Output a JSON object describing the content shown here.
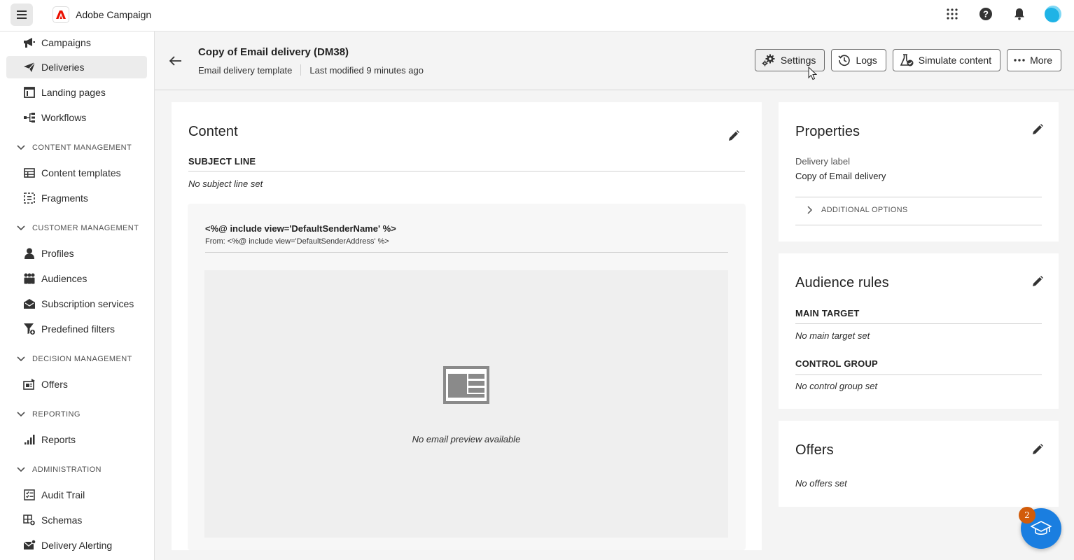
{
  "app": {
    "name": "Adobe Campaign"
  },
  "sidebar": {
    "items_top": [
      {
        "label": "Campaigns",
        "icon": "megaphone-icon"
      },
      {
        "label": "Deliveries",
        "icon": "paper-plane-icon",
        "active": true
      },
      {
        "label": "Landing pages",
        "icon": "browser-window-icon"
      },
      {
        "label": "Workflows",
        "icon": "workflow-icon"
      }
    ],
    "sections": [
      {
        "title": "CONTENT MANAGEMENT",
        "items": [
          {
            "label": "Content templates",
            "icon": "template-icon"
          },
          {
            "label": "Fragments",
            "icon": "fragment-icon"
          }
        ]
      },
      {
        "title": "CUSTOMER MANAGEMENT",
        "items": [
          {
            "label": "Profiles",
            "icon": "user-icon"
          },
          {
            "label": "Audiences",
            "icon": "group-icon"
          },
          {
            "label": "Subscription services",
            "icon": "envelope-icon"
          },
          {
            "label": "Predefined filters",
            "icon": "filter-icon"
          }
        ]
      },
      {
        "title": "DECISION MANAGEMENT",
        "items": [
          {
            "label": "Offers",
            "icon": "offer-icon"
          }
        ]
      },
      {
        "title": "REPORTING",
        "items": [
          {
            "label": "Reports",
            "icon": "bar-chart-icon"
          }
        ]
      },
      {
        "title": "ADMINISTRATION",
        "items": [
          {
            "label": "Audit Trail",
            "icon": "checklist-icon"
          },
          {
            "label": "Schemas",
            "icon": "schema-icon"
          },
          {
            "label": "Delivery Alerting",
            "icon": "alert-mail-icon"
          }
        ]
      }
    ]
  },
  "header": {
    "title": "Copy of Email delivery (DM38)",
    "type": "Email delivery template",
    "modified": "Last modified 9 minutes ago",
    "buttons": {
      "settings": "Settings",
      "logs": "Logs",
      "simulate": "Simulate content",
      "more": "More"
    }
  },
  "content": {
    "title": "Content",
    "subject_label": "SUBJECT LINE",
    "subject_value": "No subject line set",
    "sender_name": "<%@ include view='DefaultSenderName' %>",
    "sender_from": "From: <%@ include view='DefaultSenderAddress' %>",
    "preview_empty": "No email preview available"
  },
  "properties": {
    "title": "Properties",
    "delivery_label_caption": "Delivery label",
    "delivery_label_value": "Copy of Email delivery",
    "additional_options": "ADDITIONAL OPTIONS"
  },
  "audience": {
    "title": "Audience rules",
    "main_target_label": "MAIN TARGET",
    "main_target_value": "No main target set",
    "control_group_label": "CONTROL GROUP",
    "control_group_value": "No control group set"
  },
  "offers": {
    "title": "Offers",
    "value": "No offers set"
  },
  "coach": {
    "badge": "2"
  }
}
